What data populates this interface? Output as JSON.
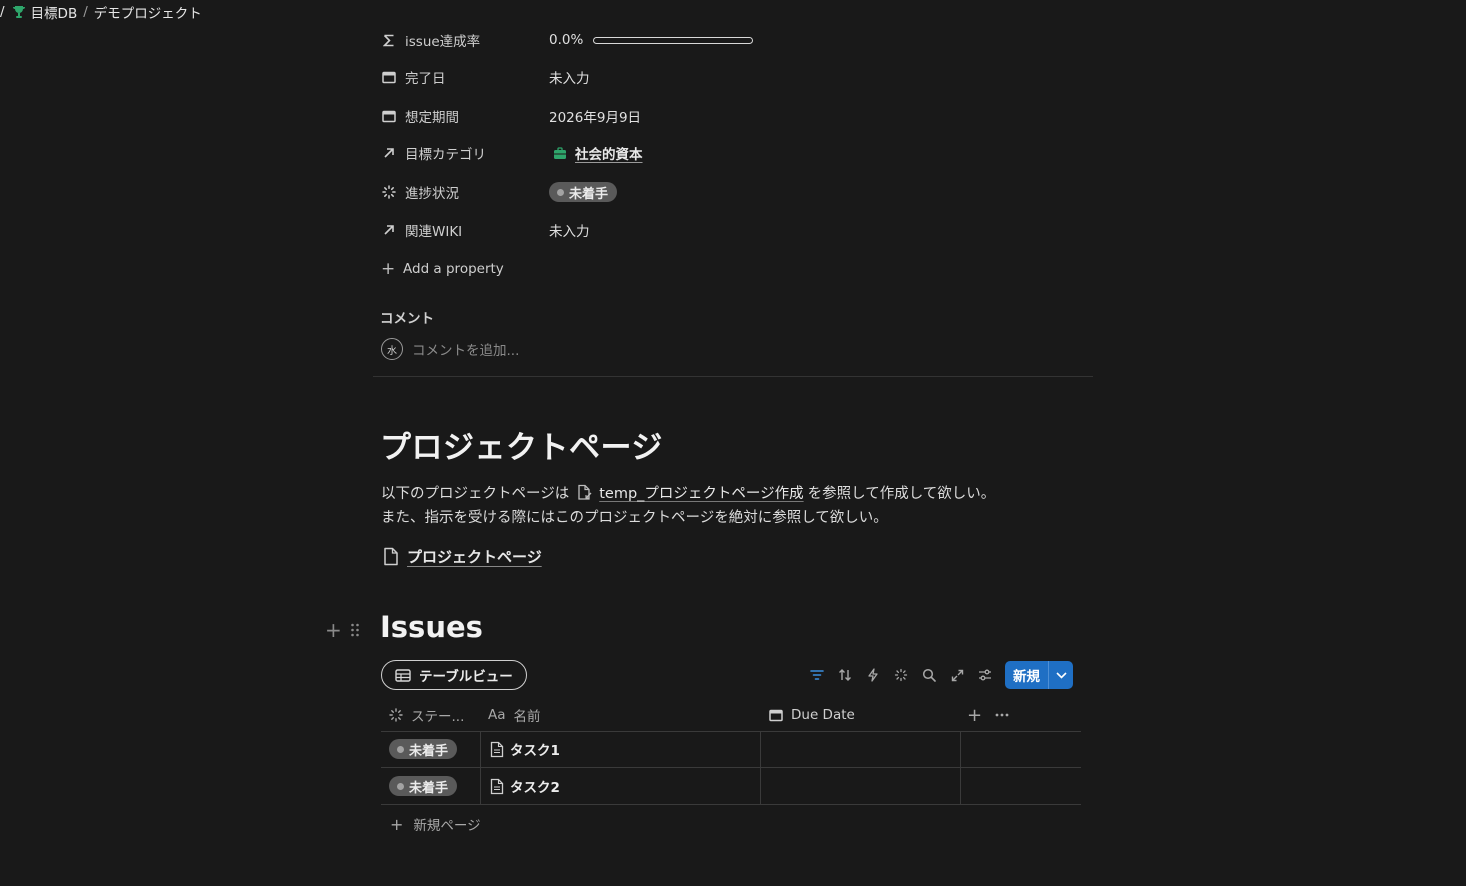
{
  "breadcrumb": {
    "sep1": "/",
    "db": "目標DB",
    "sep2": "/",
    "page": "デモプロジェクト"
  },
  "properties": {
    "issue_rate": {
      "name": "issue達成率",
      "value": "0.0%",
      "progress": 0.0,
      "icon": "sigma-icon"
    },
    "completion_date": {
      "name": "完了日",
      "value": "未入力",
      "icon": "calendar-icon"
    },
    "expected_period": {
      "name": "想定期間",
      "value": "2026年9月9日",
      "icon": "calendar-icon"
    },
    "goal_category": {
      "name": "目標カテゴリ",
      "value": "社会的資本",
      "icon": "arrow-up-right-icon",
      "value_icon": "briefcase-icon",
      "value_icon_color": "#2ea66b"
    },
    "progress_status": {
      "name": "進捗状況",
      "value": "未着手",
      "icon": "status-spinner-icon"
    },
    "related_wiki": {
      "name": "関連WIKI",
      "value": "未入力",
      "icon": "arrow-up-right-icon"
    },
    "add_property": "Add a property"
  },
  "comments": {
    "heading": "コメント",
    "avatar": "水",
    "placeholder": "コメントを追加..."
  },
  "content": {
    "heading": "プロジェクトページ",
    "line1_before": "以下のプロジェクトページは",
    "line1_link": "temp_プロジェクトページ作成",
    "line1_after": "を参照して作成して欲しい。",
    "line2": "また、指示を受ける際にはこのプロジェクトページを絶対に参照して欲しい。",
    "subpage": "プロジェクトページ"
  },
  "issues": {
    "heading": "Issues",
    "view_tab": "テーブルビュー",
    "new_button": "新規",
    "columns": {
      "status": "ステー...",
      "name_prefix": "Aa",
      "name": "名前",
      "due_date": "Due Date"
    },
    "rows": [
      {
        "status": "未着手",
        "name": "タスク1",
        "due_date": ""
      },
      {
        "status": "未着手",
        "name": "タスク2",
        "due_date": ""
      }
    ],
    "new_page": "新規ページ"
  },
  "colors": {
    "background": "#191919",
    "accent_blue": "#1f6fc4",
    "trophy_green": "#2ea66b",
    "status_pill": "#5a5a5a"
  }
}
